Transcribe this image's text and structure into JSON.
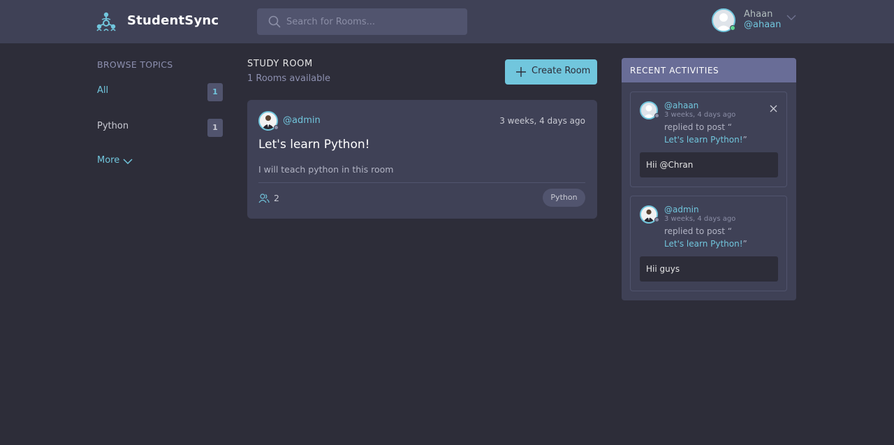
{
  "header": {
    "brand": "StudentSync",
    "search_placeholder": "Search for Rooms...",
    "user": {
      "name": "Ahaan",
      "handle": "@ahaan",
      "status_color": "#5dd693"
    }
  },
  "topics": {
    "title": "BROWSE TOPICS",
    "items": [
      {
        "label": "All",
        "count": "1"
      },
      {
        "label": "Python",
        "count": "1"
      }
    ],
    "more_label": "More"
  },
  "rooms": {
    "heading": "STUDY ROOM",
    "subheading": "1 Rooms available",
    "create_label": "Create Room",
    "list": [
      {
        "host": "@admin",
        "time": "3 weeks, 4 days ago",
        "title": "Let's learn Python!",
        "description": "I will teach python in this room",
        "participants": "2",
        "topic": "Python"
      }
    ]
  },
  "activities": {
    "title": "RECENT ACTIVITIES",
    "items": [
      {
        "user": "@ahaan",
        "time": "3 weeks, 4 days ago",
        "action": "replied to post “",
        "link": "Let's learn Python!",
        "close_quote": "”",
        "message": "Hii @Chran"
      },
      {
        "user": "@admin",
        "time": "3 weeks, 4 days ago",
        "action": "replied to post “",
        "link": "Let's learn Python!",
        "close_quote": "”",
        "message": "Hii guys"
      }
    ]
  },
  "colors": {
    "background": "#2d2d39",
    "panel": "#3f4156",
    "accent": "#71c6dd",
    "activities_header": "#696d97"
  }
}
